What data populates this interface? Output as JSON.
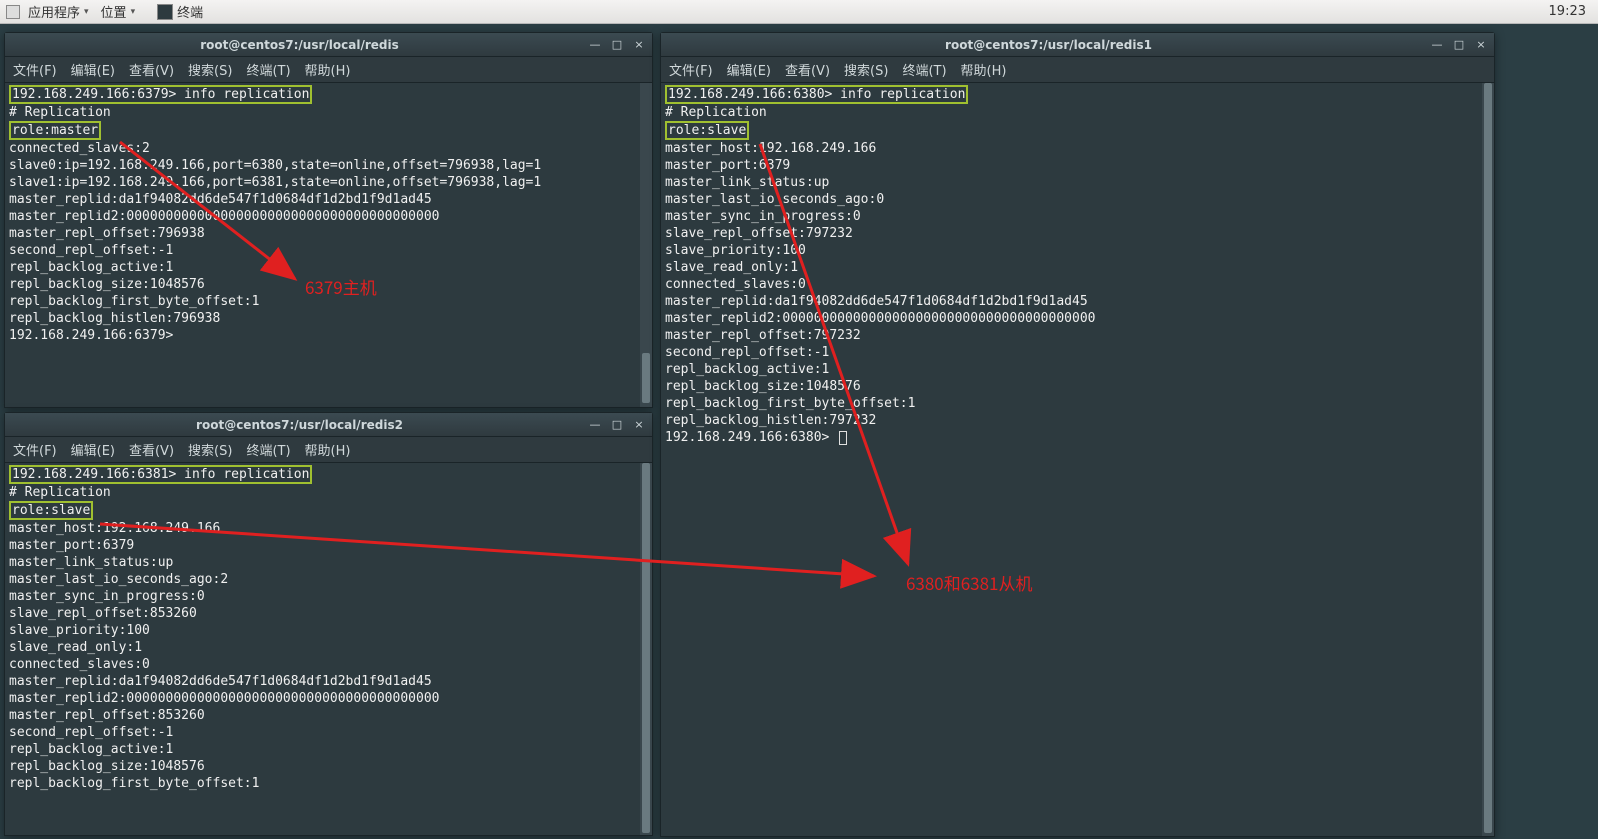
{
  "panel": {
    "apps_label": "应用程序",
    "places_label": "位置",
    "task_label": "终端",
    "clock": "19:23"
  },
  "menus": {
    "file": "文件(F)",
    "edit": "编辑(E)",
    "view": "查看(V)",
    "search": "搜索(S)",
    "terminal": "终端(T)",
    "help": "帮助(H)"
  },
  "win_btn": {
    "min": "—",
    "max": "□",
    "close": "×"
  },
  "windows": {
    "top_left": {
      "title": "root@centos7:/usr/local/redis",
      "prompt": "192.168.249.166:6379> info replication",
      "role_line": "role:master",
      "pre_role": "# Replication",
      "rest": "connected_slaves:2\nslave0:ip=192.168.249.166,port=6380,state=online,offset=796938,lag=1\nslave1:ip=192.168.249.166,port=6381,state=online,offset=796938,lag=1\nmaster_replid:da1f94082dd6de547f1d0684df1d2bd1f9d1ad45\nmaster_replid2:0000000000000000000000000000000000000000\nmaster_repl_offset:796938\nsecond_repl_offset:-1\nrepl_backlog_active:1\nrepl_backlog_size:1048576\nrepl_backlog_first_byte_offset:1\nrepl_backlog_histlen:796938\n192.168.249.166:6379> "
    },
    "bottom_left": {
      "title": "root@centos7:/usr/local/redis2",
      "prompt": "192.168.249.166:6381> info replication",
      "role_line": "role:slave",
      "pre_role": "# Replication",
      "rest": "master_host:192.168.249.166\nmaster_port:6379\nmaster_link_status:up\nmaster_last_io_seconds_ago:2\nmaster_sync_in_progress:0\nslave_repl_offset:853260\nslave_priority:100\nslave_read_only:1\nconnected_slaves:0\nmaster_replid:da1f94082dd6de547f1d0684df1d2bd1f9d1ad45\nmaster_replid2:0000000000000000000000000000000000000000\nmaster_repl_offset:853260\nsecond_repl_offset:-1\nrepl_backlog_active:1\nrepl_backlog_size:1048576\nrepl_backlog_first_byte_offset:1"
    },
    "right": {
      "title": "root@centos7:/usr/local/redis1",
      "prompt": "192.168.249.166:6380> info replication",
      "role_line": "role:slave",
      "pre_role": "# Replication",
      "rest": "master_host:192.168.249.166\nmaster_port:6379\nmaster_link_status:up\nmaster_last_io_seconds_ago:0\nmaster_sync_in_progress:0\nslave_repl_offset:797232\nslave_priority:100\nslave_read_only:1\nconnected_slaves:0\nmaster_replid:da1f94082dd6de547f1d0684df1d2bd1f9d1ad45\nmaster_replid2:0000000000000000000000000000000000000000\nmaster_repl_offset:797232\nsecond_repl_offset:-1\nrepl_backlog_active:1\nrepl_backlog_size:1048576\nrepl_backlog_first_byte_offset:1\nrepl_backlog_histlen:797232",
      "final_prompt": "192.168.249.166:6380> "
    }
  },
  "annotations": {
    "master": "6379主机",
    "slaves": "6380和6381从机"
  }
}
